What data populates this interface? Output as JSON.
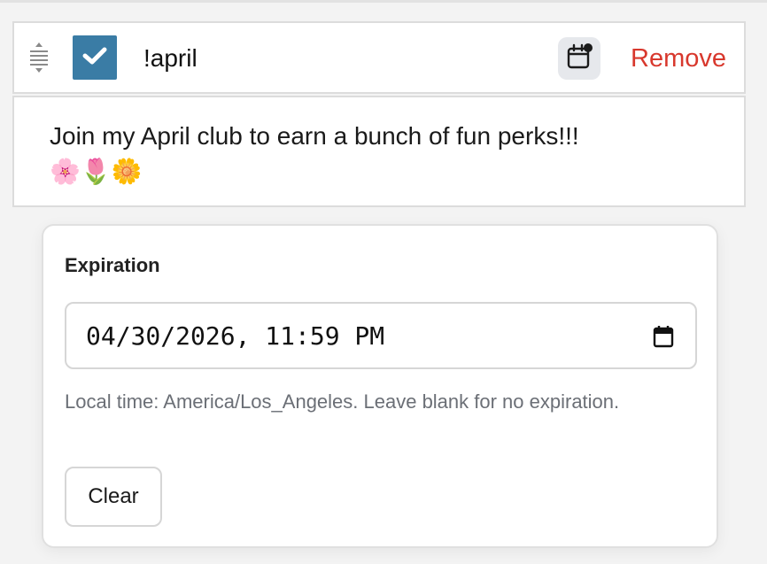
{
  "command": {
    "enabled": true,
    "name": "!april",
    "remove_label": "Remove",
    "description": "Join my April club to earn a bunch of fun perks!!! 🌸🌷🌼"
  },
  "icons": {
    "drag": "drag-handle-icon",
    "check": "check-icon",
    "calendar": "calendar-with-dot-icon",
    "input_calendar": "calendar-icon"
  },
  "expiration": {
    "label": "Expiration",
    "value": "04/30/2026, 11:59 PM",
    "hint": "Local time: America/Los_Angeles. Leave blank for no expiration.",
    "clear_label": "Clear"
  },
  "colors": {
    "checkbox": "#3a7ca5",
    "remove": "#d8382d",
    "calendar_bg": "#e6e8ec"
  }
}
